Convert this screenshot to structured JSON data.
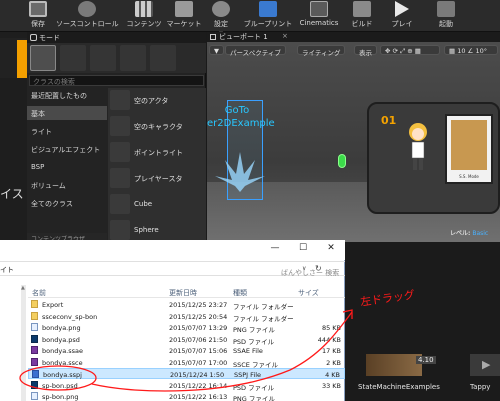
{
  "toolbar": {
    "buttons": [
      {
        "label": "保存",
        "icon": "save-icon"
      },
      {
        "label": "ソースコントロール",
        "icon": "source-control-icon"
      },
      {
        "label": "コンテンツ",
        "icon": "content-icon"
      },
      {
        "label": "マーケット",
        "icon": "marketplace-icon"
      },
      {
        "label": "設定",
        "icon": "settings-icon"
      },
      {
        "label": "ブループリント",
        "icon": "blueprint-icon"
      },
      {
        "label": "Cinematics",
        "icon": "cinematics-icon"
      },
      {
        "label": "ビルド",
        "icon": "build-icon"
      },
      {
        "label": "プレイ",
        "icon": "play-icon"
      },
      {
        "label": "起動",
        "icon": "launch-icon"
      }
    ]
  },
  "left_side": {
    "partial_text": "イス"
  },
  "modes": {
    "tab_title": "モード",
    "search_placeholder": "クラスの検索",
    "categories": [
      {
        "label": "最近配置したもの",
        "selected": false
      },
      {
        "label": "基本",
        "selected": true
      },
      {
        "label": "ライト",
        "selected": false
      },
      {
        "label": "ビジュアルエフェクト",
        "selected": false
      },
      {
        "label": "BSP",
        "selected": false
      },
      {
        "label": "ボリューム",
        "selected": false
      },
      {
        "label": "全てのクラス",
        "selected": false
      }
    ],
    "items": [
      {
        "label": "空のアクタ"
      },
      {
        "label": "空のキャラクタ"
      },
      {
        "label": "ポイントライト"
      },
      {
        "label": "プレイヤースタ"
      },
      {
        "label": "Cube"
      },
      {
        "label": "Sphere"
      }
    ]
  },
  "viewport": {
    "tab_title": "ビューポート 1",
    "close_glyph": "×",
    "perspective_label": "パースペクティブ",
    "lighting_label": "ライティング",
    "show_label": "表示",
    "scene_text_line1": "GoTo",
    "scene_text_line2": "er2DExample",
    "screen_number": "01",
    "card_caption": "S.S. Mode",
    "level_label": "レベル:",
    "level_value": "Basic"
  },
  "bottom": {
    "tab_label": "コンテンツブラウザ",
    "tiles": [
      {
        "label": "StateMachineExamples",
        "version": "4.10"
      },
      {
        "label": "Tappy"
      }
    ]
  },
  "explorer": {
    "addr_left": "イト",
    "search_placeholder": "ばんやしさー 検索",
    "window_buttons": {
      "minimize": "—",
      "maximize": "☐",
      "close": "✕"
    },
    "columns": {
      "name": "名前",
      "date": "更新日時",
      "type": "種類",
      "size": "サイズ"
    },
    "files": [
      {
        "name": "Export",
        "date": "2015/12/25 23:27",
        "type": "ファイル フォルダー",
        "size": "",
        "icon": "folder",
        "selected": false
      },
      {
        "name": "ssceconv_sp-bon",
        "date": "2015/12/25 20:54",
        "type": "ファイル フォルダー",
        "size": "",
        "icon": "folder",
        "selected": false
      },
      {
        "name": "bondya.png",
        "date": "2015/07/07 13:29",
        "type": "PNG ファイル",
        "size": "85 KB",
        "icon": "png",
        "selected": false
      },
      {
        "name": "bondya.psd",
        "date": "2015/07/06 21:50",
        "type": "PSD ファイル",
        "size": "444 KB",
        "icon": "psd",
        "selected": false
      },
      {
        "name": "bondya.ssae",
        "date": "2015/07/07 15:06",
        "type": "SSAE File",
        "size": "17 KB",
        "icon": "ss",
        "selected": false
      },
      {
        "name": "bondya.ssce",
        "date": "2015/07/07 17:00",
        "type": "SSCE ファイル",
        "size": "2 KB",
        "icon": "ss",
        "selected": false
      },
      {
        "name": "bondya.sspj",
        "date": "2015/12/24 1:50",
        "type": "SSPJ File",
        "size": "4 KB",
        "icon": "sscp",
        "selected": true
      },
      {
        "name": "sp-bon.psd",
        "date": "2015/12/22 16:14",
        "type": "PSD ファイル",
        "size": "33 KB",
        "icon": "psd",
        "selected": false
      },
      {
        "name": "sp-bon.png",
        "date": "2015/12/22 16:13",
        "type": "PNG ファイル",
        "size": "",
        "icon": "png",
        "selected": false
      }
    ]
  },
  "annotation": {
    "text": "左ドラッグ",
    "color": "#ff1a1a"
  }
}
